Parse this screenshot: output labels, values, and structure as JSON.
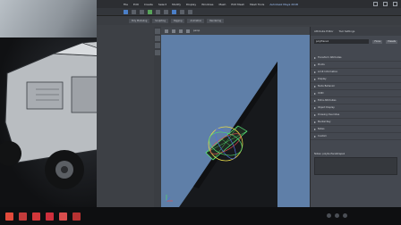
{
  "maya": {
    "menu_items": [
      "File",
      "Edit",
      "Create",
      "Select",
      "Modify",
      "Display",
      "Windows",
      "Mesh",
      "Edit Mesh",
      "Mesh Tools"
    ],
    "title_right": "Autodesk Maya 2018",
    "tool_tabs": [
      "Poly Modeling",
      "Sculpting",
      "Rigging",
      "Animation",
      "Rendering"
    ],
    "shelf_colors": [
      "#4b7fc7",
      "#58a55a",
      "#5b6068"
    ]
  },
  "viewport": {
    "camera_label": "persp",
    "background": "#5f7fa8"
  },
  "attribute_editor": {
    "tabs": [
      "Attribute Editor",
      "Tool Settings"
    ],
    "node_name": "polyPlane1",
    "focus_label": "Focus",
    "presets_label": "Presets",
    "sections": [
      {
        "label": "Transform Attributes",
        "value": ""
      },
      {
        "label": "Pivots",
        "value": ""
      },
      {
        "label": "Limit Information",
        "value": ""
      },
      {
        "label": "Display",
        "value": ""
      },
      {
        "label": "Node Behavior",
        "value": ""
      },
      {
        "label": "UUID",
        "value": ""
      },
      {
        "label": "Extra Attributes",
        "value": ""
      },
      {
        "label": "Object Display",
        "value": ""
      },
      {
        "label": "Drawing Overrides",
        "value": ""
      },
      {
        "label": "Mental Ray",
        "value": ""
      },
      {
        "label": "Notes",
        "value": ""
      },
      {
        "label": "Custom",
        "value": ""
      }
    ],
    "notes_label": "Notes: polySurfaceShape1"
  },
  "taskbar": {
    "icons": [
      {
        "name": "start-icon",
        "color": "#e24a3b"
      },
      {
        "name": "search-icon",
        "color": "#c23b3b"
      },
      {
        "name": "folder-icon",
        "color": "#d3373a"
      },
      {
        "name": "browser-icon",
        "color": "#ce2f3c"
      },
      {
        "name": "app-icon",
        "color": "#d94d4d"
      },
      {
        "name": "maya-icon",
        "color": "#b83232"
      }
    ],
    "time": "",
    "date": ""
  }
}
